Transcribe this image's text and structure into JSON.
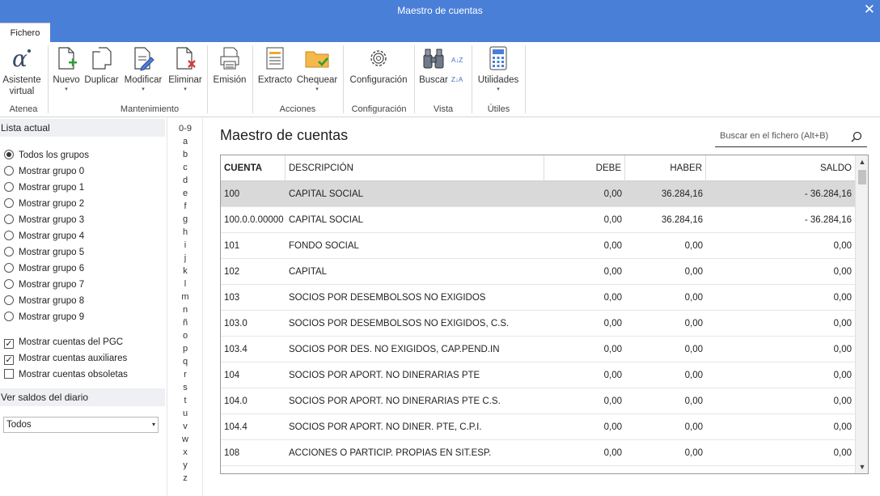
{
  "window": {
    "title": "Maestro de cuentas",
    "close_glyph": "✕"
  },
  "tabs": [
    {
      "label": "Fichero",
      "active": true
    }
  ],
  "ribbon": {
    "buttons": {
      "asistente": {
        "line1": "Asistente",
        "line2": "virtual",
        "icon": "alpha-icon"
      },
      "nuevo": {
        "label": "Nuevo",
        "icon": "new-document-icon"
      },
      "duplicar": {
        "label": "Duplicar",
        "icon": "duplicate-icon"
      },
      "modificar": {
        "label": "Modificar",
        "icon": "edit-document-icon"
      },
      "eliminar": {
        "label": "Eliminar",
        "icon": "delete-document-icon"
      },
      "emision": {
        "label": "Emisión",
        "icon": "printer-icon"
      },
      "extracto": {
        "label": "Extracto",
        "icon": "extract-icon"
      },
      "chequear": {
        "label": "Chequear",
        "icon": "folder-check-icon"
      },
      "configuracion": {
        "label": "Configuración",
        "icon": "gear-icon"
      },
      "buscar": {
        "label": "Buscar",
        "icon": "binoculars-icon"
      },
      "utilidades": {
        "label": "Utilidades",
        "icon": "calculator-icon"
      }
    },
    "groups": {
      "atenea": "Atenea",
      "mantenimiento": "Mantenimiento",
      "acciones": "Acciones",
      "configuracion": "Configuración",
      "vista": "Vista",
      "utiles": "Útiles"
    },
    "dropdown_arrow": "▾",
    "sort_icons": {
      "az": "A↓Z",
      "za": "Z↓A"
    }
  },
  "left": {
    "lista_actual": "Lista actual",
    "groups": [
      {
        "label": "Todos los grupos",
        "selected": true
      },
      {
        "label": "Mostrar grupo 0",
        "selected": false
      },
      {
        "label": "Mostrar grupo 1",
        "selected": false
      },
      {
        "label": "Mostrar grupo 2",
        "selected": false
      },
      {
        "label": "Mostrar grupo 3",
        "selected": false
      },
      {
        "label": "Mostrar grupo 4",
        "selected": false
      },
      {
        "label": "Mostrar grupo 5",
        "selected": false
      },
      {
        "label": "Mostrar grupo 6",
        "selected": false
      },
      {
        "label": "Mostrar grupo 7",
        "selected": false
      },
      {
        "label": "Mostrar grupo 8",
        "selected": false
      },
      {
        "label": "Mostrar grupo 9",
        "selected": false
      }
    ],
    "checks": [
      {
        "label": "Mostrar cuentas del PGC",
        "checked": true
      },
      {
        "label": "Mostrar cuentas auxiliares",
        "checked": true
      },
      {
        "label": "Mostrar cuentas obsoletas",
        "checked": false
      }
    ],
    "ver_saldos": "Ver saldos del diario",
    "saldos_select_value": "Todos"
  },
  "alpha_index": [
    "0-9",
    "a",
    "b",
    "c",
    "d",
    "e",
    "f",
    "g",
    "h",
    "i",
    "j",
    "k",
    "l",
    "m",
    "n",
    "ñ",
    "o",
    "p",
    "q",
    "r",
    "s",
    "t",
    "u",
    "v",
    "w",
    "x",
    "y",
    "z"
  ],
  "main": {
    "title": "Maestro de cuentas",
    "search_placeholder": "Buscar en el fichero (Alt+B)",
    "columns": {
      "cuenta": "CUENTA",
      "descripcion": "DESCRIPCIÓN",
      "debe": "DEBE",
      "haber": "HABER",
      "saldo": "SALDO"
    },
    "rows": [
      {
        "cuenta": "100",
        "descripcion": "CAPITAL SOCIAL",
        "debe": "0,00",
        "haber": "36.284,16",
        "saldo": "- 36.284,16",
        "selected": true
      },
      {
        "cuenta": "100.0.0.00000",
        "descripcion": "CAPITAL SOCIAL",
        "debe": "0,00",
        "haber": "36.284,16",
        "saldo": "- 36.284,16"
      },
      {
        "cuenta": "101",
        "descripcion": "FONDO SOCIAL",
        "debe": "0,00",
        "haber": "0,00",
        "saldo": "0,00"
      },
      {
        "cuenta": "102",
        "descripcion": "CAPITAL",
        "debe": "0,00",
        "haber": "0,00",
        "saldo": "0,00"
      },
      {
        "cuenta": "103",
        "descripcion": "SOCIOS POR DESEMBOLSOS NO EXIGIDOS",
        "debe": "0,00",
        "haber": "0,00",
        "saldo": "0,00"
      },
      {
        "cuenta": "103.0",
        "descripcion": "SOCIOS POR DESEMBOLSOS NO EXIGIDOS, C.S.",
        "debe": "0,00",
        "haber": "0,00",
        "saldo": "0,00"
      },
      {
        "cuenta": "103.4",
        "descripcion": "SOCIOS POR DES. NO EXIGIDOS, CAP.PEND.IN",
        "debe": "0,00",
        "haber": "0,00",
        "saldo": "0,00"
      },
      {
        "cuenta": "104",
        "descripcion": "SOCIOS POR APORT. NO DINERARIAS PTE",
        "debe": "0,00",
        "haber": "0,00",
        "saldo": "0,00"
      },
      {
        "cuenta": "104.0",
        "descripcion": "SOCIOS POR APORT. NO DINERARIAS PTE C.S.",
        "debe": "0,00",
        "haber": "0,00",
        "saldo": "0,00"
      },
      {
        "cuenta": "104.4",
        "descripcion": "SOCIOS POR APORT. NO DINER. PTE, C.P.I.",
        "debe": "0,00",
        "haber": "0,00",
        "saldo": "0,00"
      },
      {
        "cuenta": "108",
        "descripcion": "ACCIONES O PARTICIP. PROPIAS EN SIT.ESP.",
        "debe": "0,00",
        "haber": "0,00",
        "saldo": "0,00"
      }
    ]
  },
  "colors": {
    "titlebar": "#4a7fd8",
    "selected_row": "#d9d9d9",
    "accent_green": "#2e9e3a",
    "accent_red": "#d83a3a",
    "accent_orange": "#f0a830"
  }
}
